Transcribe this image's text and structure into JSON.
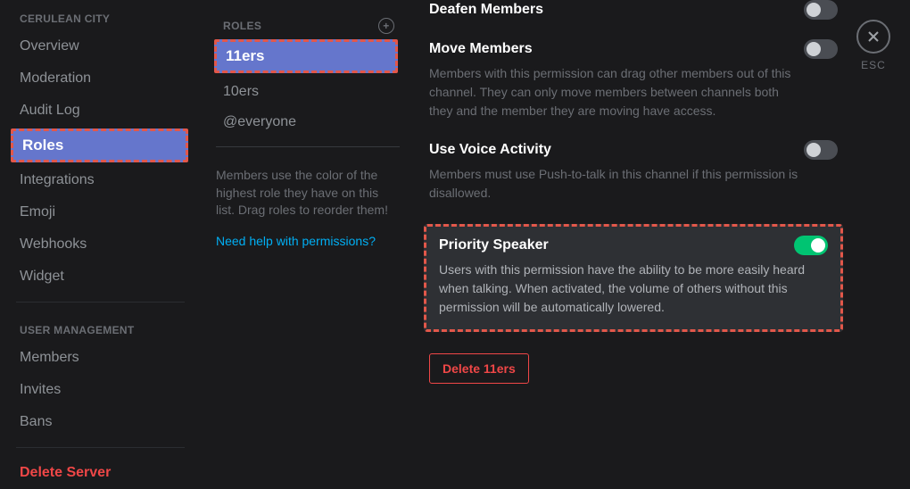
{
  "sidebar": {
    "header1": "Cerulean City",
    "header2": "User Management",
    "items1": [
      "Overview",
      "Moderation",
      "Audit Log"
    ],
    "roles_label": "Roles",
    "items2": [
      "Integrations",
      "Emoji",
      "Webhooks",
      "Widget"
    ],
    "items3": [
      "Members",
      "Invites",
      "Bans"
    ],
    "delete_server": "Delete Server"
  },
  "roles": {
    "header": "Roles",
    "selected": "11ers",
    "others": [
      "10ers",
      "@everyone"
    ],
    "hint": "Members use the color of the highest role they have on this list. Drag roles to reorder them!",
    "help_link": "Need help with permissions?"
  },
  "perms": {
    "deafen": {
      "title": "Deafen Members",
      "desc": "",
      "on": false
    },
    "move": {
      "title": "Move Members",
      "desc": "Members with this permission can drag other members out of this channel. They can only move members between channels both they and the member they are moving have access.",
      "on": false
    },
    "voice": {
      "title": "Use Voice Activity",
      "desc": "Members must use Push-to-talk in this channel if this permission is disallowed.",
      "on": false
    },
    "priority": {
      "title": "Priority Speaker",
      "desc": "Users with this permission have the ability to be more easily heard when talking. When activated, the volume of others without this permission will be automatically lowered.",
      "on": true
    },
    "delete_label": "Delete 11ers"
  },
  "close": {
    "esc": "ESC"
  }
}
